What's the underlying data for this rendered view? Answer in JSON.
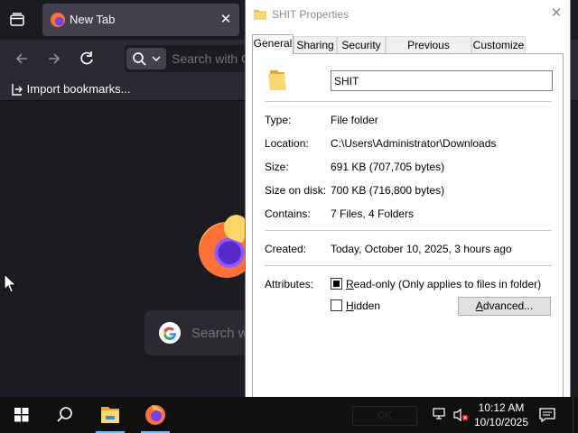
{
  "browser": {
    "tab_title": "New Tab",
    "url_placeholder": "Search with G",
    "import_bookmarks_label": "Import bookmarks...",
    "newtab_search_placeholder": "Search w"
  },
  "dialog": {
    "title": "SHIT Properties",
    "tabs": [
      "General",
      "Sharing",
      "Security",
      "Previous Versions",
      "Customize"
    ],
    "active_tab": "General",
    "name_value": "SHIT",
    "properties": {
      "type_label": "Type:",
      "type_value": "File folder",
      "location_label": "Location:",
      "location_value": "C:\\Users\\Administrator\\Downloads",
      "size_label": "Size:",
      "size_value": "691 KB (707,705 bytes)",
      "size_on_disk_label": "Size on disk:",
      "size_on_disk_value": "700 KB (716,800 bytes)",
      "contains_label": "Contains:",
      "contains_value": "7 Files, 4 Folders",
      "created_label": "Created:",
      "created_value": "Today, October 10, 2025, 3 hours ago",
      "attributes_label": "Attributes:"
    },
    "readonly_label_u": "R",
    "readonly_label_rest": "ead-only (Only applies to files in folder)",
    "hidden_label_u": "H",
    "hidden_label_rest": "idden",
    "advanced_label_u": "A",
    "advanced_label_rest": "dvanced...",
    "readonly_checked": true,
    "hidden_checked": false,
    "ghost_ok_label": "OK"
  },
  "taskbar": {
    "time": "10:12 AM",
    "date": "10/10/2025"
  },
  "colors": {
    "folder_yellow": "#f8d775",
    "firefox_orange": "#ff7139",
    "taskbar_accent": "#76b9ed"
  },
  "icons": [
    "tab-list-icon",
    "firefox-icon",
    "close-icon",
    "back-arrow-icon",
    "forward-arrow-icon",
    "reload-icon",
    "search-icon",
    "chevron-down-icon",
    "import-icon",
    "google-icon",
    "folder-icon",
    "windows-start-icon",
    "search-icon",
    "file-explorer-icon",
    "network-icon",
    "volume-muted-icon",
    "notification-icon",
    "mouse-cursor"
  ]
}
